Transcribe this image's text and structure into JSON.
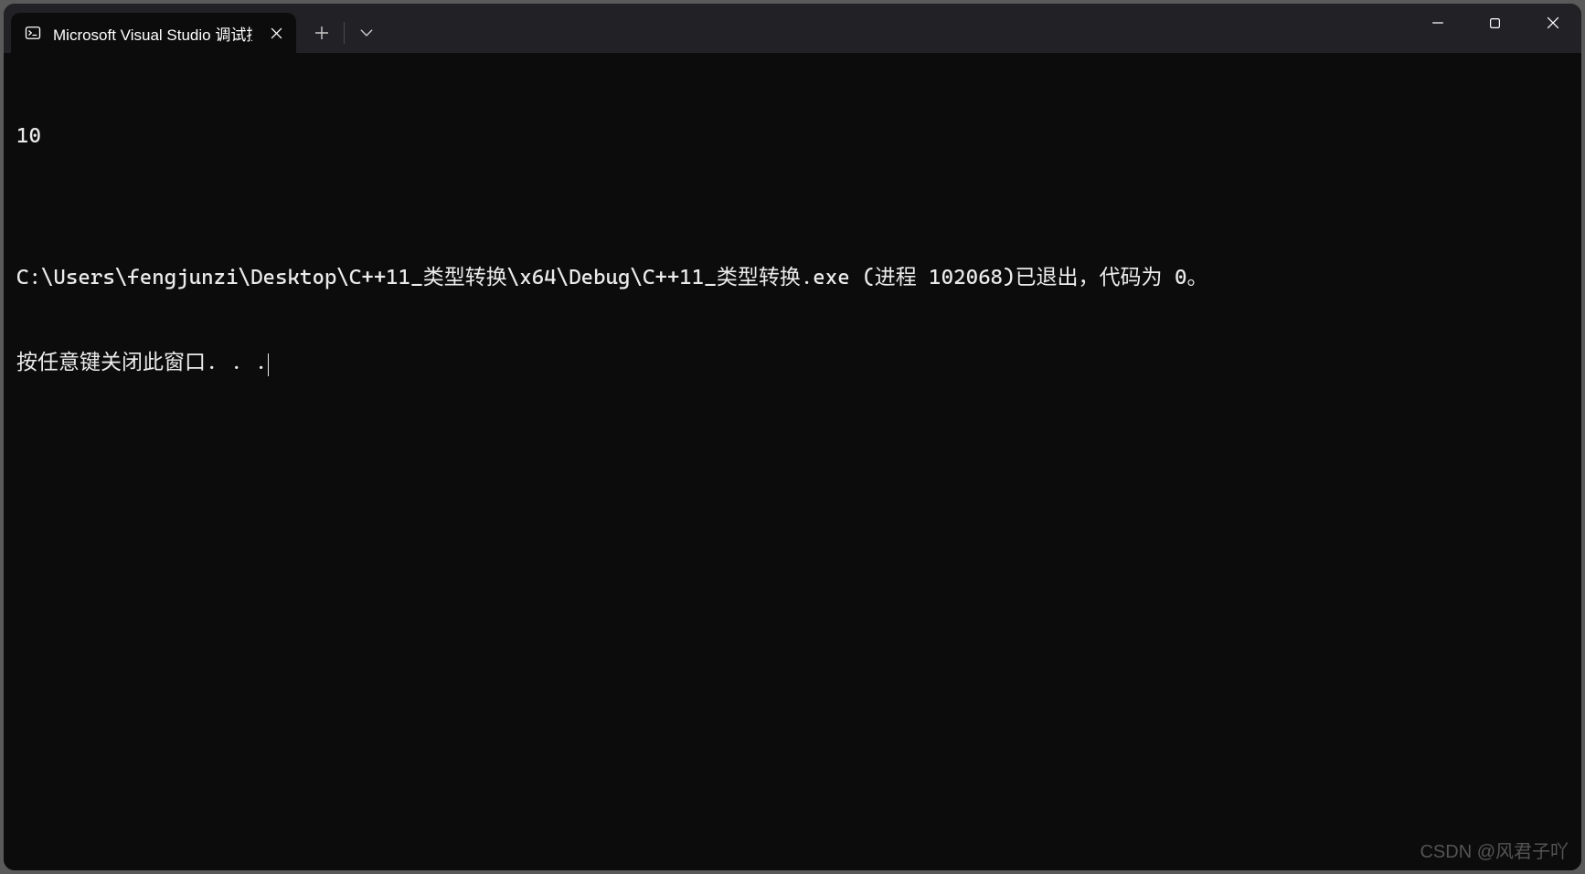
{
  "tab": {
    "title": "Microsoft Visual Studio 调试控",
    "icon": "console-icon"
  },
  "terminal": {
    "lines": [
      "10",
      "",
      "C:\\Users\\fengjunzi\\Desktop\\C++11_类型转换\\x64\\Debug\\C++11_类型转换.exe (进程 102068)已退出，代码为 0。",
      "按任意键关闭此窗口. . ."
    ]
  },
  "watermark": "CSDN @风君子吖"
}
